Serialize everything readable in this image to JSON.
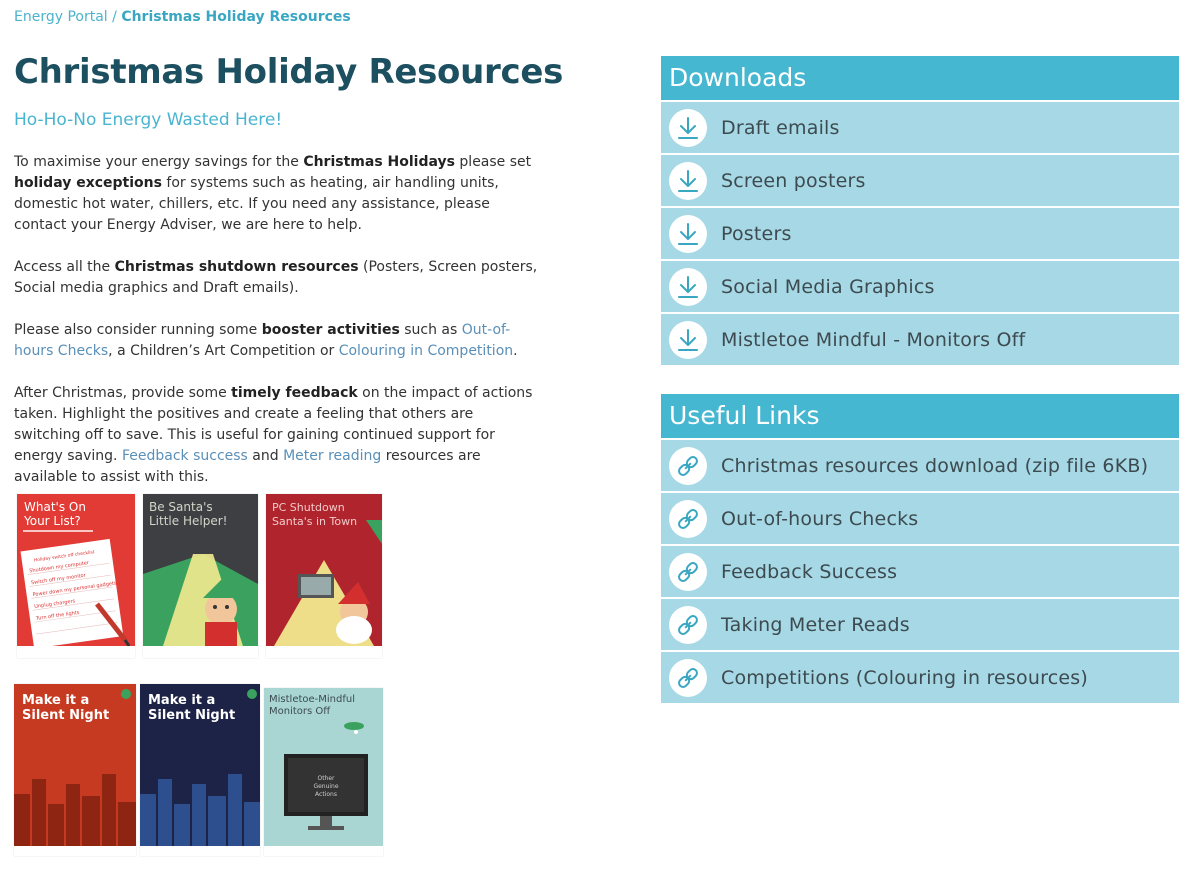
{
  "breadcrumb": {
    "parent": "Energy Portal",
    "separator": " / ",
    "current": "Christmas Holiday Resources"
  },
  "page": {
    "title": "Christmas Holiday Resources",
    "subtitle": "Ho-Ho-No Energy Wasted Here!"
  },
  "body": {
    "p1": {
      "t1": "To maximise your energy savings for the ",
      "b1": "Christmas Holidays",
      "t2": " please set ",
      "b2": "holiday exceptions",
      "t3": " for systems such as heating, air handling units, domestic hot water, chillers, etc. If you need any assistance, please contact your Energy Adviser, we are here to help."
    },
    "p2": {
      "t1": " Access all the ",
      "b1": "Christmas shutdown resources",
      "t2": " (Posters, Screen posters, Social media graphics and Draft emails)."
    },
    "p3": {
      "t1": "Please also consider running some ",
      "b1": "booster activities",
      "t2": " such as ",
      "link1": "Out-of-hours Checks",
      "t3": ", a Children’s Art Competition or ",
      "link2": "Colouring in Competition",
      "t4": "."
    },
    "p4": {
      "t1": "After Christmas, provide some ",
      "b1": "timely feedback",
      "t2": " on the impact of actions taken. Highlight the positives and create a feeling that others are switching off to save. This is useful for gaining continued support for energy saving. ",
      "link1": "Feedback success",
      "t3": " and ",
      "link2": "Meter reading",
      "t4": " resources are available to assist with this."
    }
  },
  "posters": [
    {
      "title_line1": "What's On",
      "title_line2": "Your List?",
      "list_heading": "Holiday switch off checklist",
      "items": [
        "Shutdown my computer",
        "Switch off my monitor",
        "Power down my personal gadgets",
        "Unplug chargers",
        "Turn off the lights"
      ]
    },
    {
      "title_line1": "Be Santa's",
      "title_line2": "Little Helper!"
    },
    {
      "title_line1": "PC Shutdown",
      "title_line2": "Santa's in Town"
    },
    {
      "title_line1": "Make it a",
      "title_line2": "Silent Night"
    },
    {
      "title_line1": "Make it a",
      "title_line2": "Silent Night"
    },
    {
      "title_line1": "Mistletoe-Mindful",
      "title_line2": "Monitors Off",
      "screen_text": [
        "Other",
        "Genuine",
        "Actions"
      ]
    }
  ],
  "downloads": {
    "heading": "Downloads",
    "items": [
      "Draft emails",
      "Screen posters",
      "Posters",
      "Social Media Graphics",
      "Mistletoe Mindful - Monitors Off"
    ]
  },
  "links": {
    "heading": "Useful Links",
    "items": [
      "Christmas resources download (zip file 6KB)",
      "Out-of-hours Checks",
      "Feedback Success",
      "Taking Meter Reads",
      "Competitions (Colouring in resources)"
    ]
  },
  "colors": {
    "accent": "#45b7d0",
    "row_bg": "#a6d9e5",
    "title": "#1c4f5f",
    "link": "#5a8fb8"
  },
  "icons": {
    "download": "download-arrow-icon",
    "link": "chain-link-icon"
  }
}
